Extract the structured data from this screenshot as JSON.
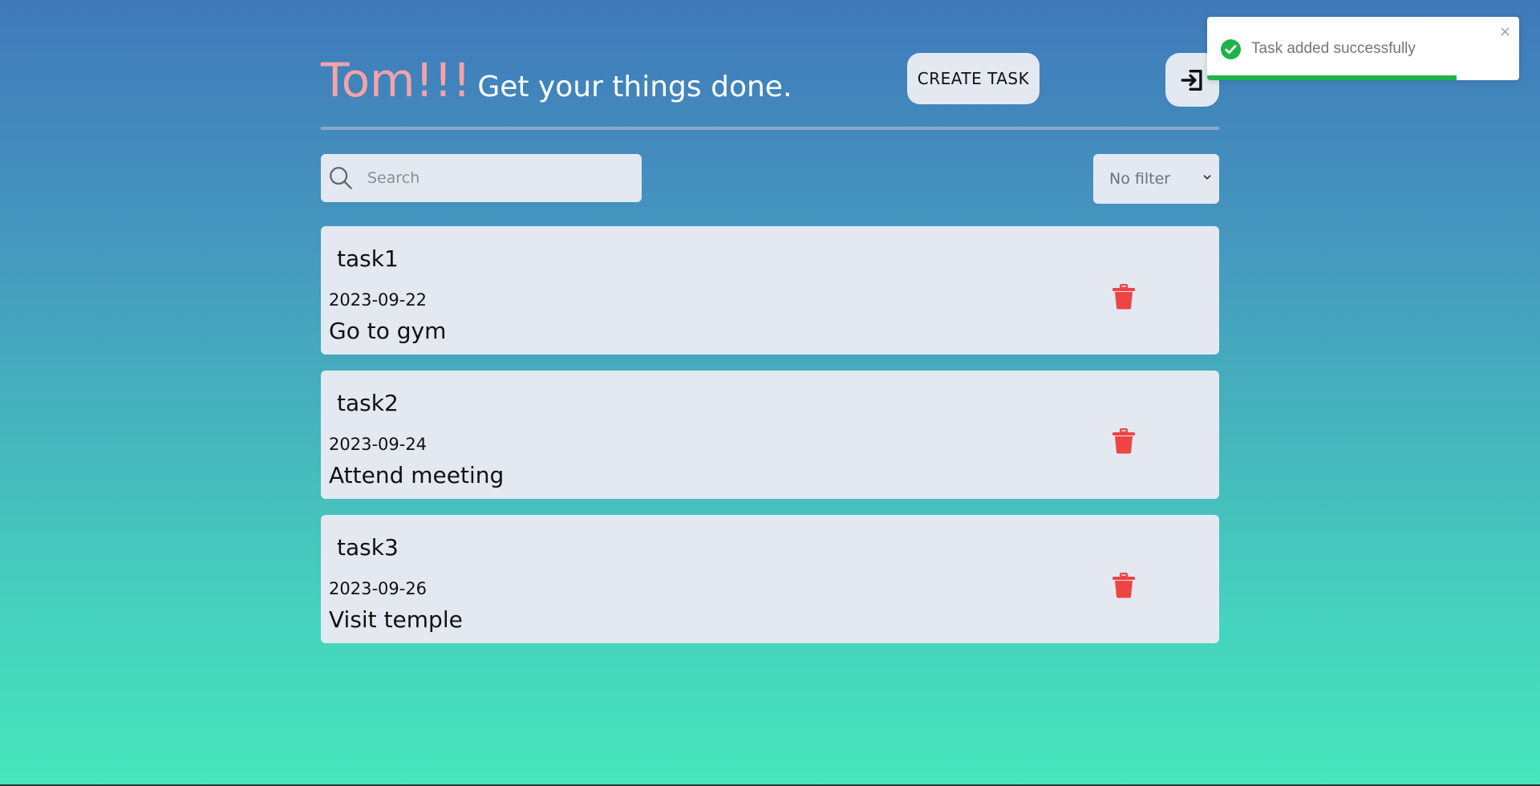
{
  "header": {
    "name": "Tom!!!",
    "tagline": "Get your things done.",
    "create_button": "CREATE TASK",
    "logout_icon": "logout-icon"
  },
  "toolbar": {
    "search_placeholder": "Search",
    "search_value": "",
    "filter_selected": "No filter"
  },
  "tasks": [
    {
      "title": "task1",
      "date": "2023-09-22",
      "description": "Go to gym"
    },
    {
      "title": "task2",
      "date": "2023-09-24",
      "description": "Attend meeting"
    },
    {
      "title": "task3",
      "date": "2023-09-26",
      "description": "Visit temple"
    }
  ],
  "toast": {
    "message": "Task added successfully",
    "close_label": "×",
    "progress": 0.8,
    "status_color": "#1fb34a"
  },
  "colors": {
    "name_color": "#f4a3a8",
    "delete_color": "#ef4444",
    "card_bg": "#e3e8f1"
  }
}
